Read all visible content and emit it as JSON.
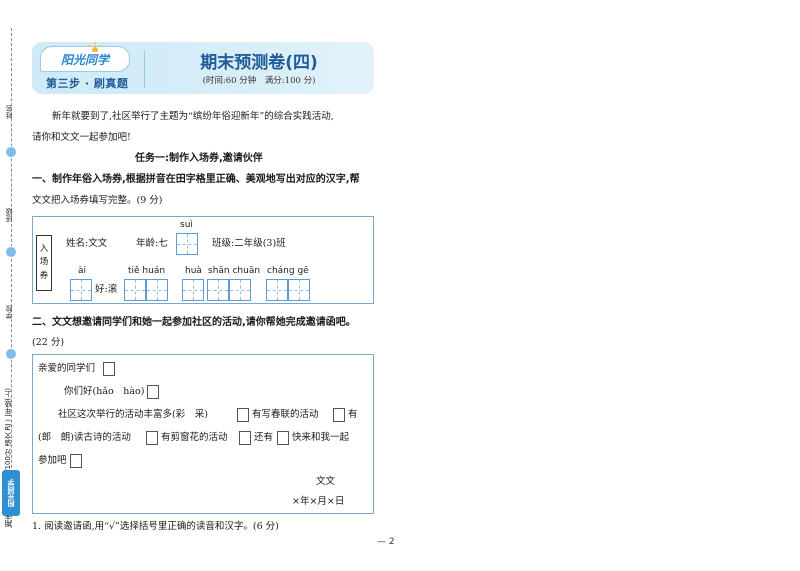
{
  "binding": {
    "labels": [
      "姓名",
      "班级",
      "学校"
    ],
    "book_title": "期末复习15天冲刺100分 语文 RJ 二年级(上)",
    "logo": "阳光同学"
  },
  "header": {
    "logo": "阳光同学",
    "step": "第三步 · 刷真题",
    "title": "期末预测卷(四)",
    "subtitle": "(时间:60 分钟　满分:100 分)"
  },
  "intro": {
    "line1": "新年就要到了,社区举行了主题为“缤纷年俗迎新年”的综合实践活动,",
    "line2": "请你和文文一起参加吧!"
  },
  "task1": {
    "title": "任务一:制作入场券,邀请伙伴"
  },
  "q1": {
    "line1": "一、制作年俗入场券,根据拼音在田字格里正确、美观地写出对应的汉字,帮",
    "line2": "文文把入场券填写完整。(9 分)",
    "ticket": {
      "tag": [
        "入",
        "场",
        "券"
      ],
      "name": "姓名:文文",
      "age": "年龄:七",
      "age_pinyin": "suì",
      "class": "班级:二年级(3)班",
      "hobby_pinyin": [
        "ài",
        "tiě huán",
        "huà",
        "shān chuān",
        "cháng gē"
      ],
      "hobby_label": "好:滚"
    }
  },
  "q2": {
    "line1": "二、文文想邀请同学们和她一起参加社区的活动,请你帮她完成邀请函吧。",
    "line2": "(22 分)",
    "letter": {
      "greeting": "亲爱的同学们",
      "hello": "你们好(hǎo　hào)",
      "body1": "社区这次举行的活动丰富多(彩　采)",
      "body1b": "有写春联的活动",
      "body1c": "有",
      "body2a": "(郎　朗)读古诗的活动",
      "body2b": "有剪窗花的活动",
      "body2c": "还有",
      "body2d": "快来和我一起",
      "body3": "参加吧",
      "signature": "文文",
      "date": "×年×月×日"
    }
  },
  "q3": {
    "text": "1. 阅读邀请函,用“√”选择括号里正确的读音和汉字。(6 分)"
  },
  "page_number": "— 2"
}
